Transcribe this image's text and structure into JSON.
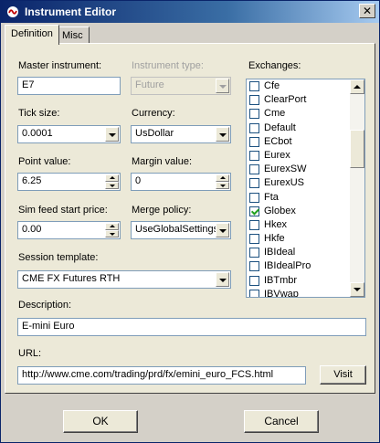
{
  "window": {
    "title": "Instrument Editor",
    "close_glyph": "✕"
  },
  "tabs": [
    {
      "label": "Definition"
    },
    {
      "label": "Misc"
    }
  ],
  "form": {
    "master_instrument": {
      "label": "Master instrument:",
      "value": "E7"
    },
    "instrument_type": {
      "label": "Instrument type:",
      "value": "Future",
      "disabled": true
    },
    "tick_size": {
      "label": "Tick size:",
      "value": "0.0001"
    },
    "currency": {
      "label": "Currency:",
      "value": "UsDollar"
    },
    "point_value": {
      "label": "Point value:",
      "value": "6.25"
    },
    "margin_value": {
      "label": "Margin value:",
      "value": "0"
    },
    "sim_feed_start_price": {
      "label": "Sim feed start price:",
      "value": "0.00"
    },
    "merge_policy": {
      "label": "Merge policy:",
      "value": "UseGlobalSettings"
    },
    "session_template": {
      "label": "Session template:",
      "value": "CME FX Futures RTH"
    },
    "description": {
      "label": "Description:",
      "value": "E-mini Euro"
    },
    "url": {
      "label": "URL:",
      "value": "http://www.cme.com/trading/prd/fx/emini_euro_FCS.html"
    },
    "visit_label": "Visit"
  },
  "exchanges": {
    "label": "Exchanges:",
    "items": [
      {
        "name": "Cfe",
        "checked": false
      },
      {
        "name": "ClearPort",
        "checked": false
      },
      {
        "name": "Cme",
        "checked": false
      },
      {
        "name": "Default",
        "checked": false
      },
      {
        "name": "ECbot",
        "checked": false
      },
      {
        "name": "Eurex",
        "checked": false
      },
      {
        "name": "EurexSW",
        "checked": false
      },
      {
        "name": "EurexUS",
        "checked": false
      },
      {
        "name": "Fta",
        "checked": false
      },
      {
        "name": "Globex",
        "checked": true
      },
      {
        "name": "Hkex",
        "checked": false
      },
      {
        "name": "Hkfe",
        "checked": false
      },
      {
        "name": "IBIdeal",
        "checked": false
      },
      {
        "name": "IBIdealPro",
        "checked": false
      },
      {
        "name": "IBTmbr",
        "checked": false
      },
      {
        "name": "IBVwap",
        "checked": false
      }
    ]
  },
  "footer": {
    "ok_label": "OK",
    "cancel_label": "Cancel"
  },
  "colors": {
    "title_bar": "#0a246a",
    "panel": "#ece9d8",
    "field_border": "#7f9db9"
  }
}
